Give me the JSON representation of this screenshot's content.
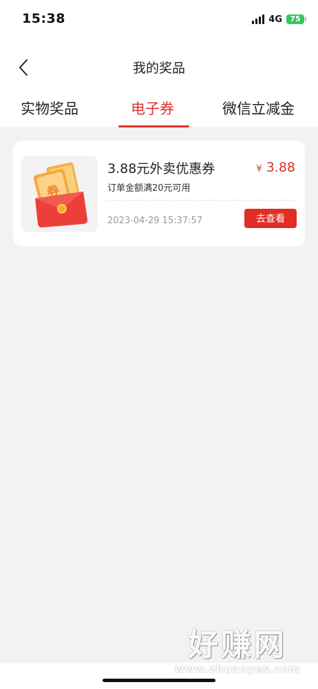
{
  "status_bar": {
    "time": "15:38",
    "network": "4G",
    "battery": "75"
  },
  "header": {
    "title": "我的奖品",
    "back_icon": "chevron-left-icon"
  },
  "tabs": [
    {
      "label": "实物奖品",
      "active": false
    },
    {
      "label": "电子券",
      "active": true
    },
    {
      "label": "微信立减金",
      "active": false
    }
  ],
  "coupon": {
    "name": "3.88元外卖优惠券",
    "currency": "¥",
    "price": "3.88",
    "condition": "订单金额满20元可用",
    "time": "2023-04-29 15:37:57",
    "action_label": "去查看",
    "image_label": "券",
    "image_icon": "coupon-envelope-icon"
  },
  "watermark": {
    "text": "好赚网",
    "url": "www.zhuanyes.com"
  },
  "colors": {
    "accent": "#e0322a",
    "background": "#f2f2f2",
    "card": "#ffffff"
  }
}
